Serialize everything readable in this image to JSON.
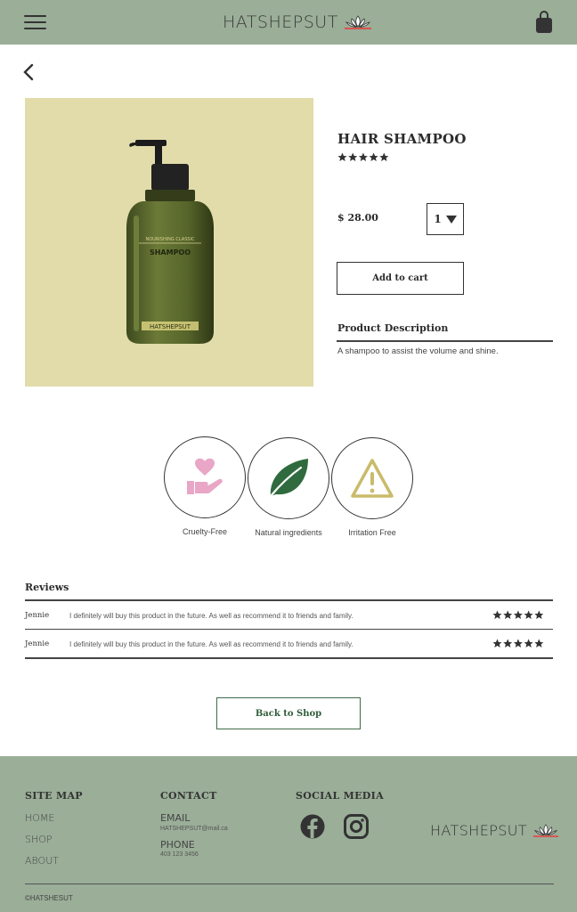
{
  "header": {
    "brand": "HATSHEPSUT"
  },
  "product": {
    "title": "HAIR SHAMPOO",
    "rating": 5,
    "price": "$ 28.00",
    "quantity": "1",
    "add_to_cart": "Add to cart",
    "description_title": "Product Description",
    "description": "A shampoo to assist the volume and shine.",
    "bottle_label": "SHAMPOO",
    "bottle_brand": "HATSHEPSUT",
    "bottle_small": "NOURISHING CLASSIC"
  },
  "features": [
    {
      "label": "Cruelty-Free",
      "icon": "heart-hand-icon",
      "color": "#e9a6c6"
    },
    {
      "label": "Natural ingredients",
      "icon": "leaf-icon",
      "color": "#2f6b3e"
    },
    {
      "label": "Irritation Free",
      "icon": "warning-icon",
      "color": "#c9bb6a"
    }
  ],
  "reviews": {
    "title": "Reviews",
    "items": [
      {
        "name": "Jennie",
        "text": "I definitely will buy this product in the future. As well as recommend it to friends and family.",
        "rating": 5
      },
      {
        "name": "Jennie",
        "text": "I definitely will buy this product in the future. As well as recommend it to friends and family.",
        "rating": 5
      }
    ]
  },
  "back_to_shop": "Back to Shop",
  "footer": {
    "sitemap_title": "SITE MAP",
    "sitemap_links": [
      "HOME",
      "SHOP",
      "ABOUT"
    ],
    "contact_title": "CONTACT",
    "email_label": "EMAIL",
    "email": "HATSHEPSUT@mail.ca",
    "phone_label": "PHONE",
    "phone": "403 123 3456",
    "social_title": "SOCIAL MEDIA",
    "brand": "HATSHEPSUT",
    "copyright": "©HATSHESUT"
  },
  "colors": {
    "header_bg": "#9aae98",
    "product_bg": "#e1dcaa",
    "accent_green": "#2f6b3e"
  }
}
